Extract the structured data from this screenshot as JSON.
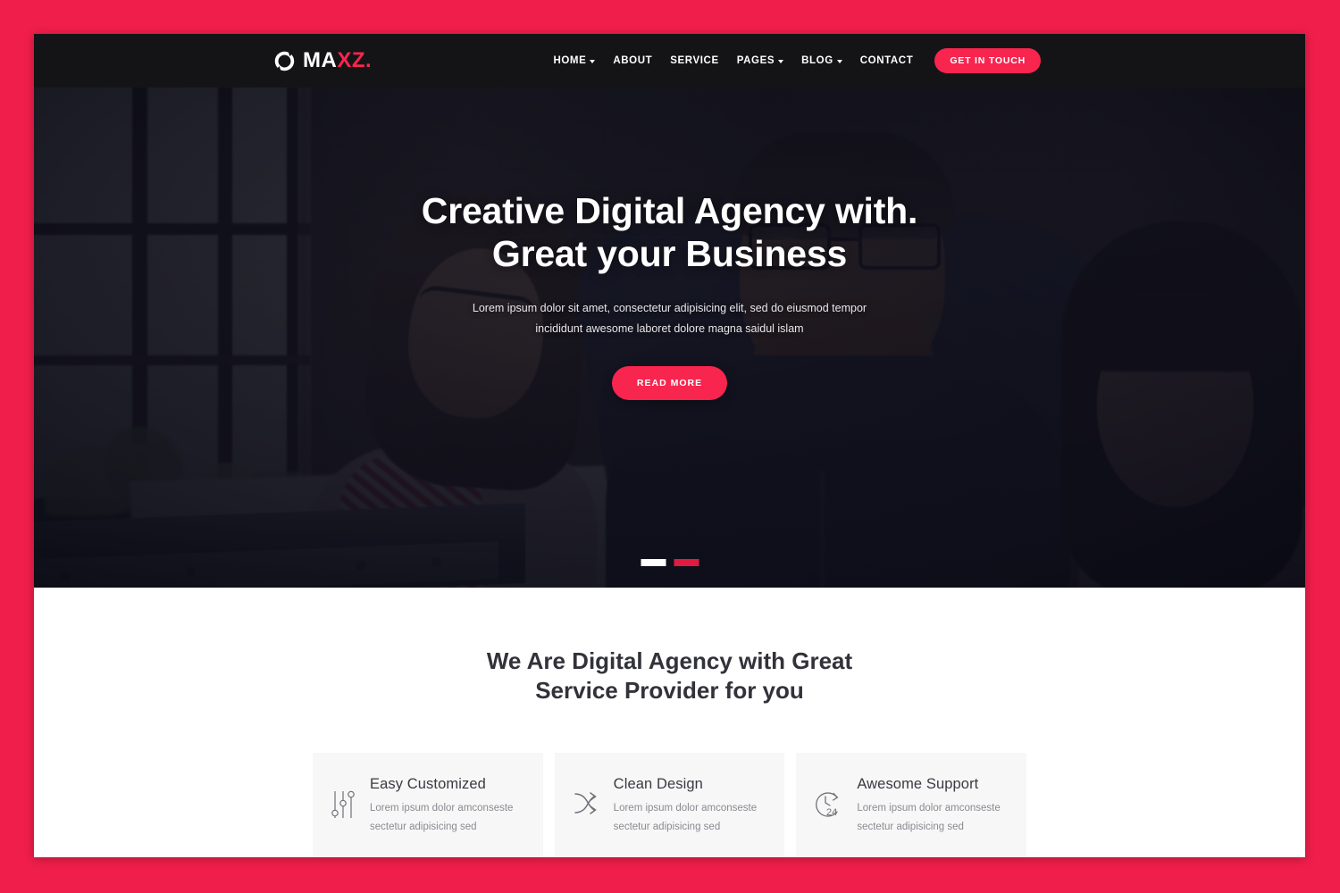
{
  "theme": {
    "frame_bg": "#F01E4B",
    "accent": "#F8254F",
    "header_bg": "#141417",
    "card_bg": "#F7F7F7",
    "slider_active": "#E01B41"
  },
  "header": {
    "logo": {
      "icon": "circle-slash-logo-icon",
      "text_primary": "MA",
      "text_accent": "XZ."
    },
    "nav": [
      {
        "label": "HOME",
        "has_dropdown": true
      },
      {
        "label": "ABOUT",
        "has_dropdown": false
      },
      {
        "label": "SERVICE",
        "has_dropdown": false
      },
      {
        "label": "PAGES",
        "has_dropdown": true
      },
      {
        "label": "BLOG",
        "has_dropdown": true
      },
      {
        "label": "CONTACT",
        "has_dropdown": false
      }
    ],
    "cta_label": "GET IN TOUCH"
  },
  "hero": {
    "title_line1": "Creative Digital Agency with.",
    "title_line2": "Great your Business",
    "subtitle_line1": "Lorem ipsum dolor sit amet, consectetur adipisicing elit, sed do eiusmod tempor",
    "subtitle_line2": "incididunt awesome laboret dolore magna saidul islam",
    "button_label": "READ MORE",
    "slides": [
      {
        "active": false
      },
      {
        "active": true
      }
    ]
  },
  "services": {
    "heading_line1": "We Are Digital Agency with Great",
    "heading_line2": "Service Provider for you",
    "cards": [
      {
        "icon": "sliders-icon",
        "title": "Easy Customized",
        "desc_line1": "Lorem ipsum dolor amconseste",
        "desc_line2": "sectetur adipisicing sed"
      },
      {
        "icon": "shuffle-icon",
        "title": "Clean Design",
        "desc_line1": "Lorem ipsum dolor amconseste",
        "desc_line2": "sectetur adipisicing sed"
      },
      {
        "icon": "clock-24-icon",
        "title": "Awesome Support",
        "desc_line1": "Lorem ipsum dolor amconseste",
        "desc_line2": "sectetur adipisicing sed"
      }
    ]
  }
}
